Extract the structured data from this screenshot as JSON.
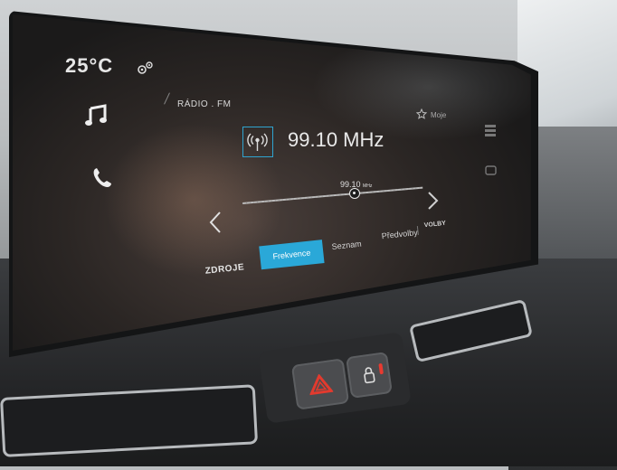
{
  "status": {
    "temperature": "25°C"
  },
  "side_nav": {
    "icons": [
      "settings-gear-icon",
      "music-note-icon",
      "phone-icon"
    ]
  },
  "radio": {
    "source_label": "RÁDIO . FM",
    "favorite_label": "Moje",
    "frequency": "99.10 MHz",
    "slider": {
      "value_label": "99.10",
      "unit_label": "MHz",
      "position_fraction": 0.62
    }
  },
  "tabs": {
    "sources": "ZDROJE",
    "frequency": "Frekvence",
    "list": "Seznam",
    "presets": "Předvolby",
    "options": "VOLBY"
  },
  "colors": {
    "accent": "#2aa8d8",
    "hazard": "#e23a2e"
  }
}
